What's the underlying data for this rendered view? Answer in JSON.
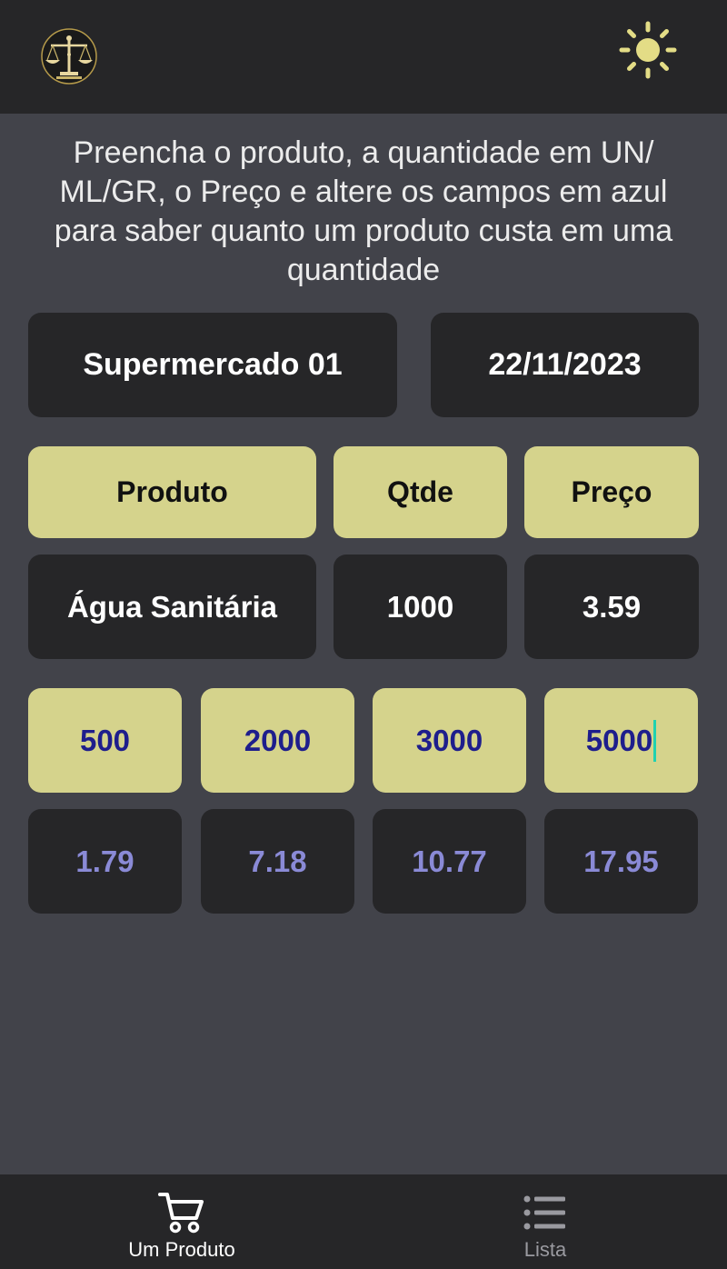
{
  "header": {
    "logo_icon": "scales-of-justice-icon",
    "theme_icon": "sun-icon"
  },
  "instructions": "Preencha o produto, a quantidade em UN/ ML/GR, o Preço e altere os campos em azul para saber quanto um produto custa em uma quantidade",
  "store": {
    "name": "Supermercado 01",
    "date": "22/11/2023"
  },
  "table_headers": {
    "product": "Produto",
    "qty": "Qtde",
    "price": "Preço"
  },
  "product_row": {
    "product": "Água Sanitária",
    "qty": "1000",
    "price": "3.59"
  },
  "compare_quantities": [
    "500",
    "2000",
    "3000",
    "5000"
  ],
  "compare_prices": [
    "1.79",
    "7.18",
    "10.77",
    "17.95"
  ],
  "bottom_nav": {
    "items": [
      {
        "label": "Um Produto",
        "icon": "shopping-cart-icon",
        "active": true
      },
      {
        "label": "Lista",
        "icon": "list-icon",
        "active": false
      }
    ]
  },
  "colors": {
    "background": "#42434a",
    "bar": "#262628",
    "accent": "#d5d38c",
    "input_text": "#1e1e8c",
    "result_text": "#8a8ad6"
  }
}
